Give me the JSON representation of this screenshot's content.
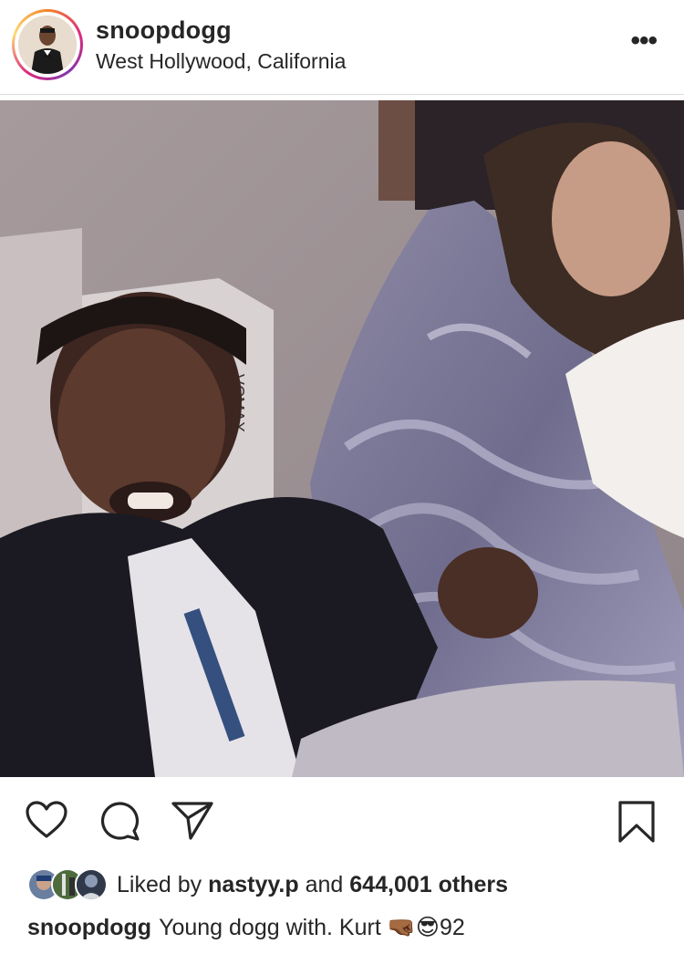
{
  "post": {
    "username": "snoopdogg",
    "location": "West Hollywood, California",
    "more_glyph": "•••",
    "photo_box_text": "VCMAX"
  },
  "actions": {
    "like": "heart-icon",
    "comment": "comment-icon",
    "share": "share-icon",
    "save": "bookmark-icon"
  },
  "likes": {
    "prefix": "Liked by",
    "first_liker": "nastyy.p",
    "and": "and",
    "others": "644,001 others"
  },
  "caption": {
    "username": "snoopdogg",
    "text": "Young dogg with. Kurt",
    "emoji_1": "🤜🏾",
    "emoji_2": "😎",
    "suffix": "92"
  }
}
